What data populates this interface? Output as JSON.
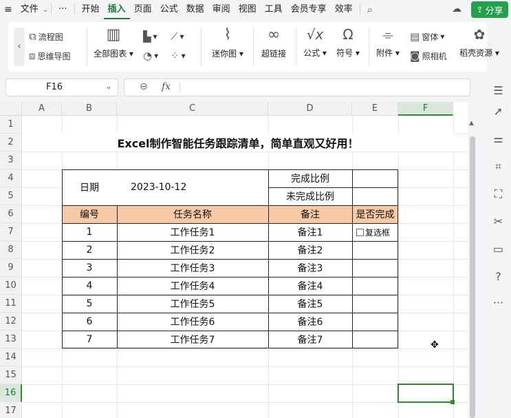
{
  "menubar": {
    "file_label": "文件",
    "more_label": "···",
    "tabs": [
      "开始",
      "插入",
      "页面",
      "公式",
      "数据",
      "审阅",
      "视图",
      "工具",
      "会员专享",
      "效率"
    ],
    "active_tab": "插入",
    "share_label": "分享"
  },
  "ribbon": {
    "flowchart": "流程图",
    "mindmap": "思维导图",
    "all_charts": "全部图表",
    "sparkline": "迷你图",
    "hyperlink": "超链接",
    "formula": "公式",
    "symbol": "符号",
    "attachment": "附件",
    "window": "窗体",
    "camera": "照相机",
    "docer": "稻壳资源"
  },
  "namebox": {
    "value": "F16"
  },
  "formulabar": {
    "fx": "fx",
    "value": ""
  },
  "columns": [
    "A",
    "B",
    "C",
    "D",
    "E",
    "F"
  ],
  "rows": [
    "1",
    "2",
    "3",
    "4",
    "5",
    "6",
    "7",
    "8",
    "9",
    "10",
    "11",
    "12",
    "13",
    "14",
    "15",
    "16",
    "17"
  ],
  "sheet": {
    "title": "Excel制作智能任务跟踪清单，简单直观又好用！",
    "date_label": "日期",
    "date_value": "2023-10-12",
    "done_ratio_label": "完成比例",
    "undone_ratio_label": "未完成比例",
    "headers": [
      "编号",
      "任务名称",
      "备注",
      "是否完成"
    ],
    "tasks": [
      {
        "no": "1",
        "name": "工作任务1",
        "note": "备注1",
        "status": "复选框"
      },
      {
        "no": "2",
        "name": "工作任务2",
        "note": "备注2",
        "status": ""
      },
      {
        "no": "3",
        "name": "工作任务3",
        "note": "备注3",
        "status": ""
      },
      {
        "no": "4",
        "name": "工作任务4",
        "note": "备注4",
        "status": ""
      },
      {
        "no": "5",
        "name": "工作任务5",
        "note": "备注5",
        "status": ""
      },
      {
        "no": "6",
        "name": "工作任务6",
        "note": "备注6",
        "status": ""
      },
      {
        "no": "7",
        "name": "工作任务7",
        "note": "备注7",
        "status": ""
      }
    ]
  },
  "colors": {
    "accent": "#1e7a3a",
    "header_fill": "#f8c9a5",
    "selection": "#2e8b2e",
    "share_bg": "#22a04a"
  }
}
